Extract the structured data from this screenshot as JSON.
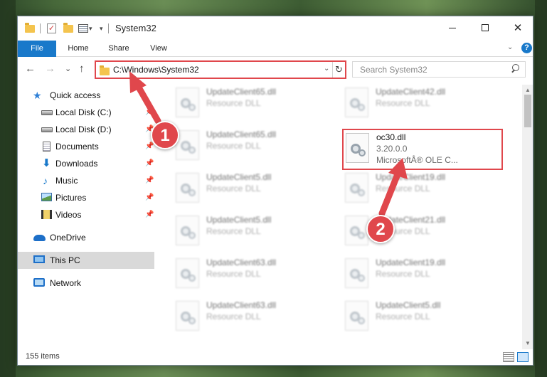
{
  "window": {
    "title": "System32",
    "controls": {
      "minimize": "",
      "maximize": "",
      "close": "✕"
    }
  },
  "ribbon": {
    "tabs": [
      "File",
      "Home",
      "Share",
      "View"
    ],
    "help_label": "?"
  },
  "navigation": {
    "back": "←",
    "forward": "→",
    "recent": "⌄",
    "up": "↑",
    "address": "C:\\Windows\\System32",
    "refresh": "↻",
    "search_placeholder": "Search System32"
  },
  "sidebar": {
    "items": [
      {
        "label": "Quick access",
        "icon": "star-icon",
        "pinned": false
      },
      {
        "label": "Local Disk (C:)",
        "icon": "drive-icon",
        "pinned": true
      },
      {
        "label": "Local Disk (D:)",
        "icon": "drive-icon",
        "pinned": true
      },
      {
        "label": "Documents",
        "icon": "documents-icon",
        "pinned": true
      },
      {
        "label": "Downloads",
        "icon": "downloads-icon",
        "pinned": true
      },
      {
        "label": "Music",
        "icon": "music-icon",
        "pinned": true
      },
      {
        "label": "Pictures",
        "icon": "pictures-icon",
        "pinned": true
      },
      {
        "label": "Videos",
        "icon": "videos-icon",
        "pinned": true
      },
      {
        "label": "OneDrive",
        "icon": "onedrive-icon",
        "pinned": false
      },
      {
        "label": "This PC",
        "icon": "this-pc-icon",
        "pinned": false,
        "selected": true
      },
      {
        "label": "Network",
        "icon": "network-icon",
        "pinned": false
      }
    ]
  },
  "files": {
    "left_column": [
      {
        "name": "UpdateClient65.dll",
        "type": "Resource DLL"
      },
      {
        "name": "UpdateClient65.dll",
        "type": "Resource DLL"
      },
      {
        "name": "UpdateClient5.dll",
        "type": "Resource DLL"
      },
      {
        "name": "UpdateClient5.dll",
        "type": "Resource DLL"
      },
      {
        "name": "UpdateClient63.dll",
        "type": "Resource DLL"
      },
      {
        "name": "UpdateClient63.dll",
        "type": "Resource DLL"
      }
    ],
    "right_column": [
      {
        "name": "UpdateClient42.dll",
        "type": "Resource DLL"
      },
      {
        "name": "UpdateClient19.dll",
        "type": "Resource DLL"
      },
      {
        "name": "UpdateClient21.dll",
        "type": "Resource DLL"
      },
      {
        "name": "UpdateClient19.dll",
        "type": "Resource DLL"
      },
      {
        "name": "UpdateClient5.dll",
        "type": "Resource DLL"
      }
    ],
    "highlighted": {
      "name": "oc30.dll",
      "version": "3.20.0.0",
      "description": "MicrosoftÂ® OLE C..."
    }
  },
  "status": {
    "item_count": "155 items"
  },
  "annotations": {
    "step1": "1",
    "step2": "2",
    "color": "#e0474c"
  }
}
